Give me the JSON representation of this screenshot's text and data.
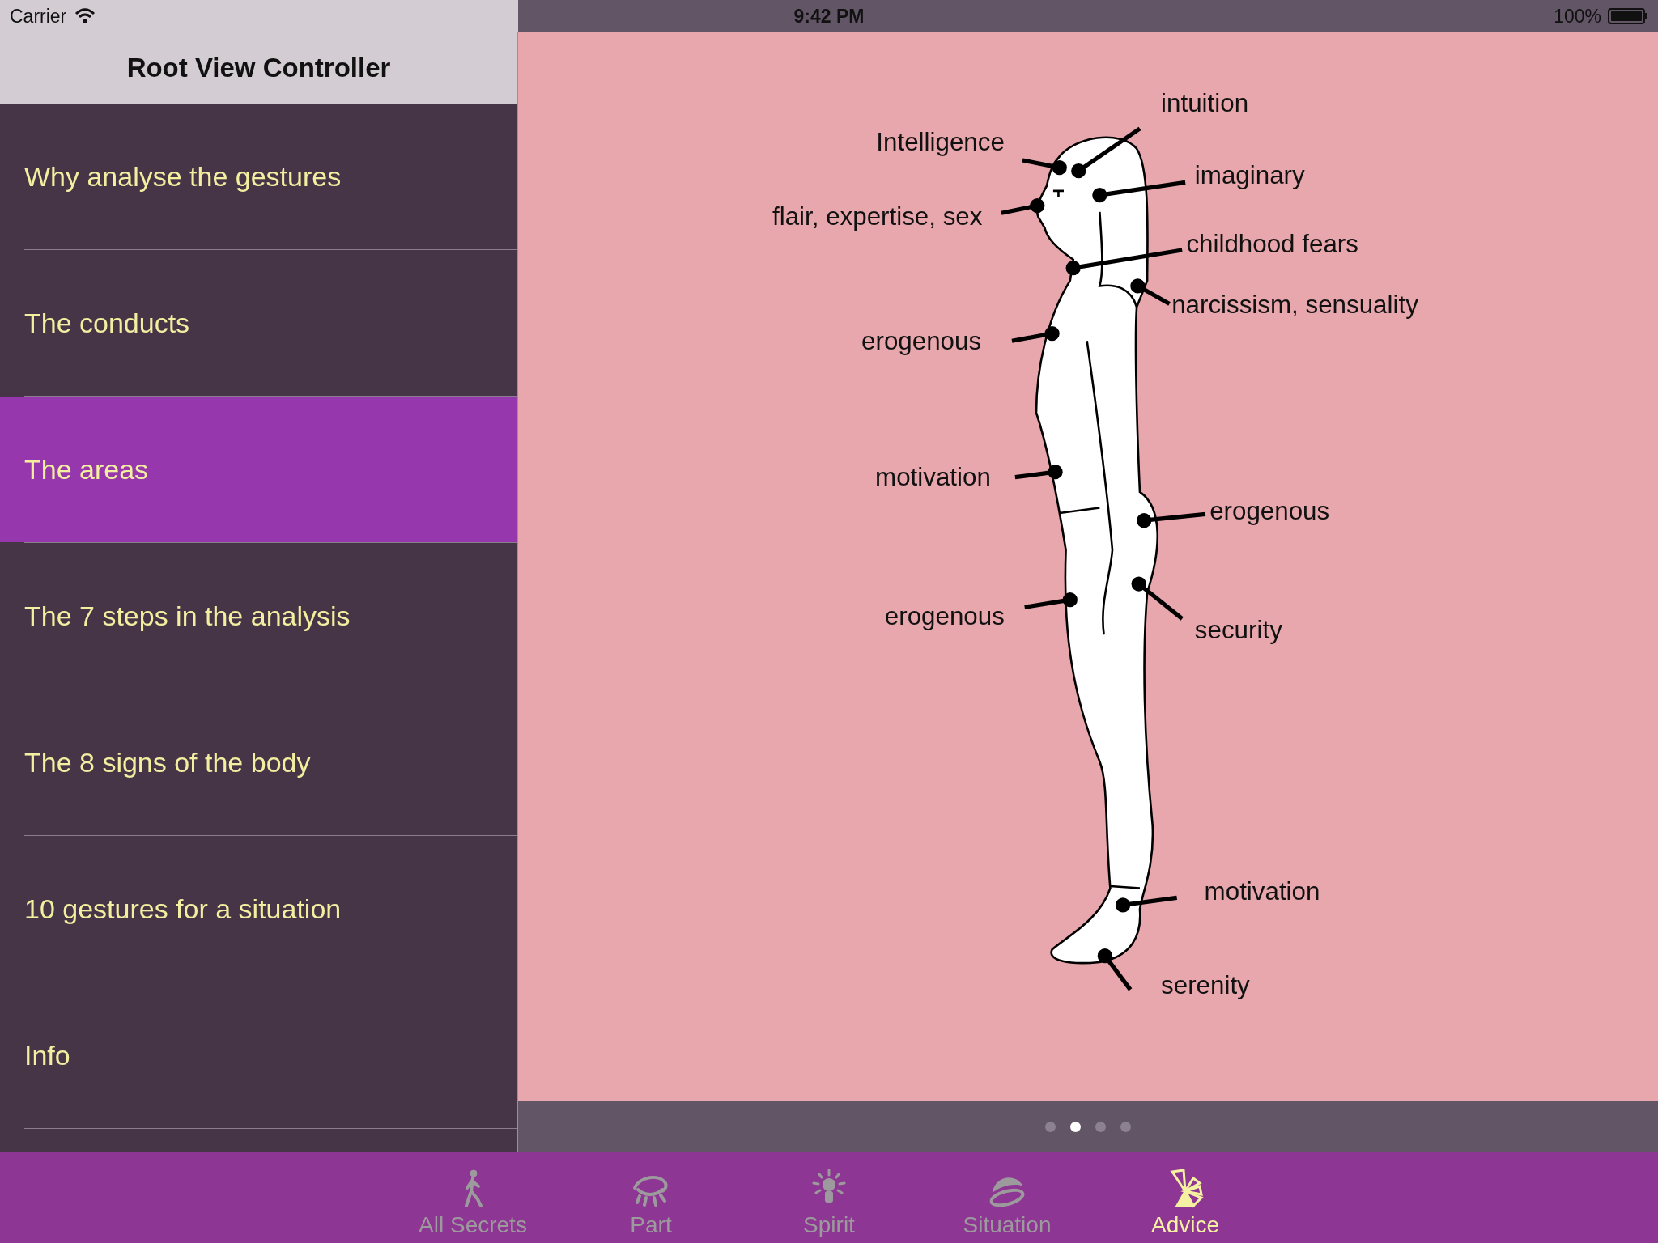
{
  "status_bar": {
    "carrier": "Carrier",
    "time": "9:42 PM",
    "battery": "100%"
  },
  "nav_bar": {
    "title": "Root View Controller"
  },
  "menu": [
    {
      "label": "Why analyse the gestures",
      "selected": false
    },
    {
      "label": "The conducts",
      "selected": false
    },
    {
      "label": "The areas",
      "selected": true
    },
    {
      "label": "The 7 steps in the analysis",
      "selected": false
    },
    {
      "label": "The 8 signs of the body",
      "selected": false
    },
    {
      "label": "10 gestures for a situation",
      "selected": false
    },
    {
      "label": "Info",
      "selected": false
    }
  ],
  "diagram": {
    "labels": [
      {
        "text": "intuition"
      },
      {
        "text": "Intelligence"
      },
      {
        "text": "imaginary"
      },
      {
        "text": "flair, expertise, sex"
      },
      {
        "text": "childhood fears"
      },
      {
        "text": "narcissism, sensuality"
      },
      {
        "text": "erogenous"
      },
      {
        "text": "motivation"
      },
      {
        "text": "erogenous"
      },
      {
        "text": "erogenous"
      },
      {
        "text": "security"
      },
      {
        "text": "motivation"
      },
      {
        "text": "serenity"
      }
    ]
  },
  "page_control": [
    {
      "selected": false
    },
    {
      "selected": true
    },
    {
      "selected": false
    },
    {
      "selected": false
    }
  ],
  "tab_bar": [
    {
      "label": "All Secrets",
      "kind": "walker",
      "selected": false
    },
    {
      "label": "Part",
      "kind": "eye",
      "selected": false
    },
    {
      "label": "Spirit",
      "kind": "bulb",
      "selected": false
    },
    {
      "label": "Situation",
      "kind": "hat",
      "selected": false
    },
    {
      "label": "Advice",
      "kind": "fan",
      "selected": true
    }
  ]
}
